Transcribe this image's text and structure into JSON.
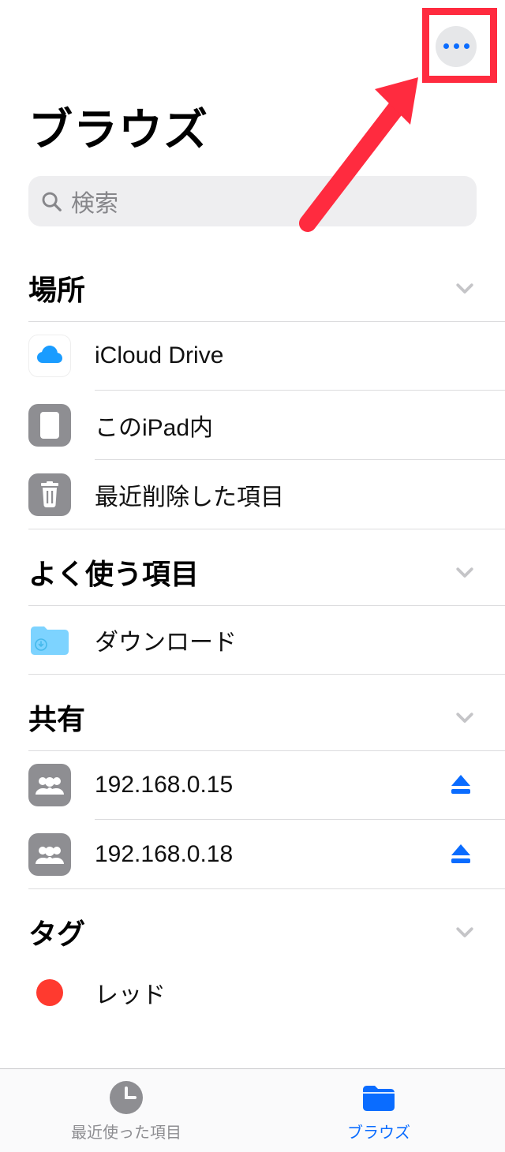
{
  "title": "ブラウズ",
  "search_placeholder": "検索",
  "sections": {
    "locations": {
      "header": "場所",
      "items": [
        {
          "label": "iCloud Drive"
        },
        {
          "label": "このiPad内"
        },
        {
          "label": "最近削除した項目"
        }
      ]
    },
    "favorites": {
      "header": "よく使う項目",
      "items": [
        {
          "label": "ダウンロード"
        }
      ]
    },
    "shared": {
      "header": "共有",
      "items": [
        {
          "label": "192.168.0.15"
        },
        {
          "label": "192.168.0.18"
        }
      ]
    },
    "tags": {
      "header": "タグ",
      "items": [
        {
          "label": "レッド",
          "color": "#ff3a2f"
        }
      ]
    }
  },
  "tabbar": {
    "recent": "最近使った項目",
    "browse": "ブラウズ"
  },
  "colors": {
    "accent": "#0a6cff",
    "highlight": "#ff2b3f",
    "gray_icon_bg": "#8e8e92",
    "cloud_blue": "#1a9cff",
    "folder_blue": "#7dd3ff"
  }
}
